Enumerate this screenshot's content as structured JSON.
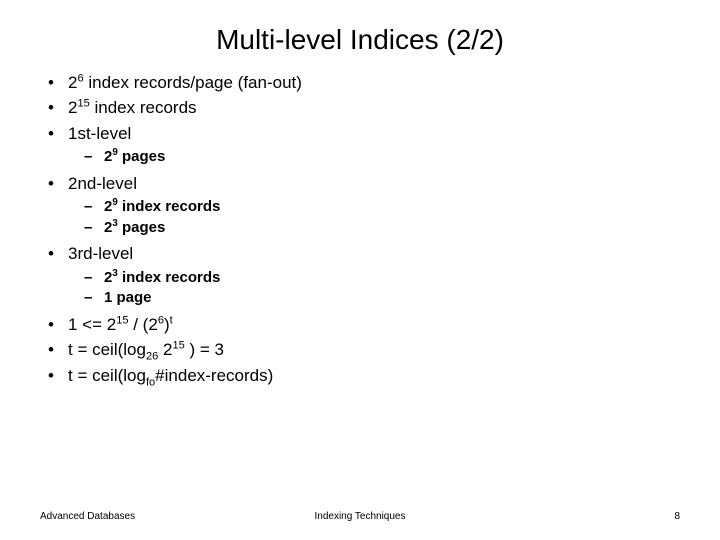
{
  "title": "Multi-level Indices (2/2)",
  "bullets": {
    "b1": {
      "base": "2",
      "exp": "6",
      "rest": " index records/page (fan-out)"
    },
    "b2": {
      "base": "2",
      "exp": "15",
      "rest": " index records"
    },
    "b3": {
      "text": "1st-level"
    },
    "b3s1": {
      "base": "2",
      "exp": "9",
      "rest": " pages"
    },
    "b4": {
      "text": "2nd-level"
    },
    "b4s1": {
      "base": "2",
      "exp": "9",
      "rest": " index records"
    },
    "b4s2": {
      "base": "2",
      "exp": "3",
      "rest": " pages"
    },
    "b5": {
      "text": "3rd-level"
    },
    "b5s1": {
      "base": "2",
      "exp": "3",
      "rest": " index records"
    },
    "b5s2": {
      "text": "1 page"
    },
    "b6": {
      "pre": "1 <= 2",
      "exp1": "15",
      "mid": " / (2",
      "exp2": "6",
      "close": ")",
      "texp": "t"
    },
    "b7": {
      "pre": "t = ceil(log",
      "sub": "26",
      "mid": " 2",
      "exp": "15",
      "post": " ) = 3"
    },
    "b8": {
      "pre": "t = ceil(log",
      "sub": "fo",
      "post": "#index-records)"
    }
  },
  "footer": {
    "left": "Advanced Databases",
    "center": "Indexing Techniques",
    "right": "8"
  }
}
